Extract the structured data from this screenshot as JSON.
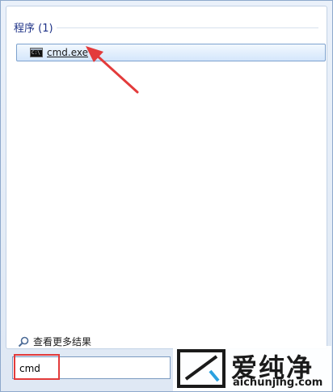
{
  "results": {
    "section_header": "程序 (1)",
    "items": [
      {
        "label": "cmd.exe",
        "icon": "cmd-icon",
        "selected": true
      }
    ]
  },
  "footer": {
    "see_more_label": "查看更多结果",
    "search_value": "cmd"
  },
  "annotation": {
    "color": "#e33b3b"
  },
  "watermark": {
    "brand": "爱纯净",
    "url": "aichunjing.com"
  }
}
